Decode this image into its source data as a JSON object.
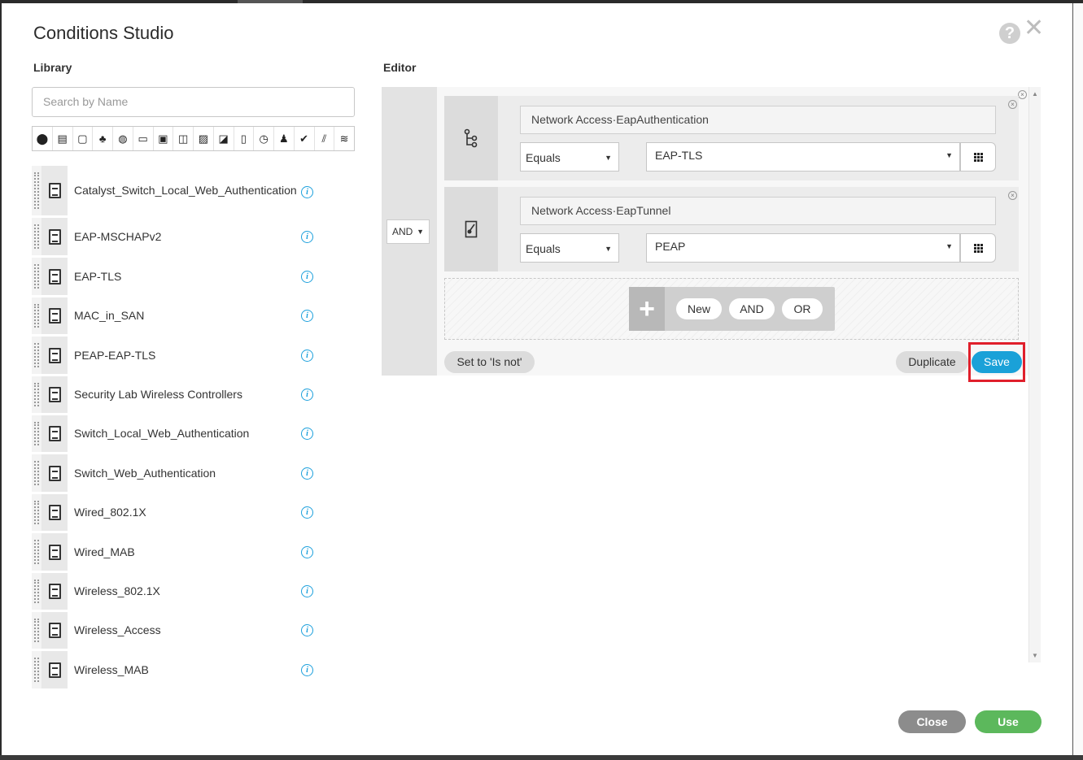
{
  "dialog": {
    "title": "Conditions Studio",
    "help_glyph": "?",
    "close_glyph": "✕"
  },
  "library": {
    "label": "Library",
    "search_placeholder": "Search by Name",
    "filter_icons": [
      "location-pin-icon",
      "device-search-icon",
      "square-icon",
      "users-icon",
      "globe-icon",
      "monitor-icon",
      "monitor-pause-icon",
      "network-device-icon",
      "endpoint-icon",
      "certificate-icon",
      "mobile-device-icon",
      "clock-icon",
      "user-icon",
      "check-circle-icon",
      "hierarchy-icon",
      "wifi-icon"
    ],
    "items": [
      {
        "name": "Catalyst_Switch_Local_Web_Authentication"
      },
      {
        "name": "EAP-MSCHAPv2"
      },
      {
        "name": "EAP-TLS"
      },
      {
        "name": "MAC_in_SAN"
      },
      {
        "name": "PEAP-EAP-TLS"
      },
      {
        "name": "Security Lab Wireless Controllers"
      },
      {
        "name": "Switch_Local_Web_Authentication"
      },
      {
        "name": "Switch_Web_Authentication"
      },
      {
        "name": "Wired_802.1X"
      },
      {
        "name": "Wired_MAB"
      },
      {
        "name": "Wireless_802.1X"
      },
      {
        "name": "Wireless_Access"
      },
      {
        "name": "Wireless_MAB"
      }
    ]
  },
  "editor": {
    "label": "Editor",
    "logic_operator": "AND",
    "conditions": [
      {
        "icon": "hierarchy-icon",
        "attribute": "Network Access·EapAuthentication",
        "operator": "Equals",
        "value": "EAP-TLS"
      },
      {
        "icon": "certificate-icon",
        "attribute": "Network Access·EapTunnel",
        "operator": "Equals",
        "value": "PEAP"
      }
    ],
    "add_bar": {
      "plus": "+",
      "new": "New",
      "and": "AND",
      "or": "OR"
    },
    "set_not_label": "Set to 'Is not'",
    "duplicate_label": "Duplicate",
    "save_label": "Save"
  },
  "footer": {
    "close_label": "Close",
    "use_label": "Use"
  },
  "colors": {
    "accent_blue": "#1aa1d8",
    "use_green": "#5cb85c",
    "close_gray": "#8c8c8c",
    "highlight_red": "#e01f2b"
  }
}
